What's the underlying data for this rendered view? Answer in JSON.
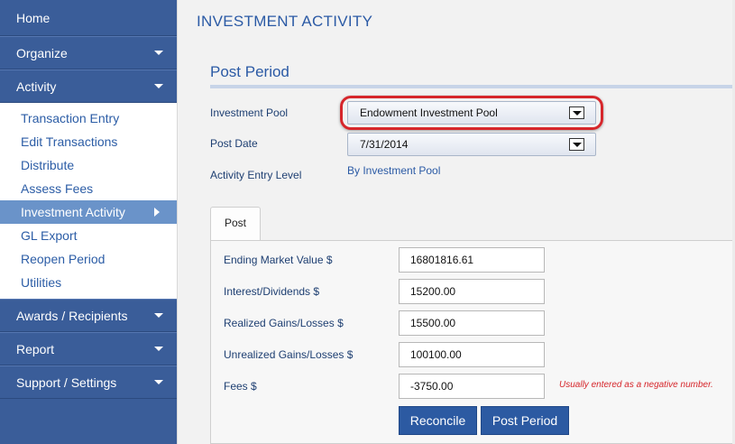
{
  "sidebar": {
    "home": "Home",
    "organize": "Organize",
    "activity": "Activity",
    "activity_items": [
      "Transaction Entry",
      "Edit Transactions",
      "Distribute",
      "Assess Fees",
      "Investment Activity",
      "GL Export",
      "Reopen Period",
      "Utilities"
    ],
    "awards": "Awards / Recipients",
    "report": "Report",
    "support": "Support / Settings"
  },
  "page": {
    "title": "INVESTMENT ACTIVITY",
    "section_title": "Post Period"
  },
  "form": {
    "pool_label": "Investment Pool",
    "pool_value": "Endowment Investment Pool",
    "date_label": "Post Date",
    "date_value": "7/31/2014",
    "level_label": "Activity Entry Level",
    "level_value": "By Investment Pool"
  },
  "tab": {
    "label": "Post"
  },
  "entries": {
    "ending_market_label": "Ending Market Value $",
    "ending_market_value": "16801816.61",
    "interest_label": "Interest/Dividends $",
    "interest_value": "15200.00",
    "realized_label": "Realized Gains/Losses $",
    "realized_value": "15500.00",
    "unrealized_label": "Unrealized Gains/Losses $",
    "unrealized_value": "100100.00",
    "fees_label": "Fees $",
    "fees_value": "-3750.00",
    "fees_hint": "Usually entered as a negative number."
  },
  "buttons": {
    "reconcile": "Reconcile",
    "post_period": "Post Period"
  },
  "colors": {
    "sidebar_bg": "#3a5d99",
    "active_item": "#6a93c9",
    "accent_text": "#2b5aa5",
    "highlight": "#d6262b",
    "button": "#2c5aa2"
  }
}
